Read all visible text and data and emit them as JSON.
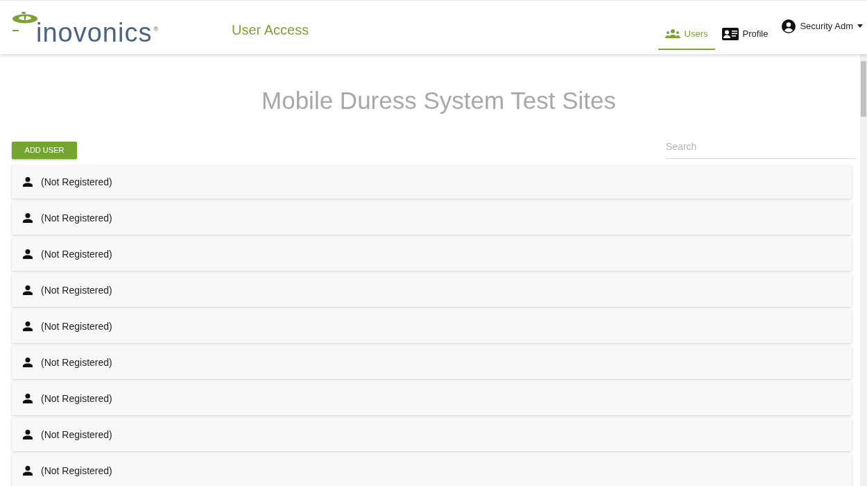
{
  "header": {
    "logo": "inovonics",
    "logo_mark": "®",
    "app_title": "User Access",
    "nav": [
      {
        "label": "Users",
        "kind": "users",
        "selected": true
      },
      {
        "label": "Profile",
        "kind": "profile",
        "selected": false
      }
    ],
    "account_menu": {
      "label": "Security Adm"
    }
  },
  "page_title": "Mobile Duress System Test Sites",
  "add_button": "ADD USER",
  "search": {
    "placeholder": "Search"
  },
  "users": [
    {
      "name": "(Not Registered)"
    },
    {
      "name": "(Not Registered)"
    },
    {
      "name": "(Not Registered)"
    },
    {
      "name": "(Not Registered)"
    },
    {
      "name": "(Not Registered)"
    },
    {
      "name": "(Not Registered)"
    },
    {
      "name": "(Not Registered)"
    },
    {
      "name": "(Not Registered)"
    },
    {
      "name": "(Not Registered)"
    }
  ]
}
